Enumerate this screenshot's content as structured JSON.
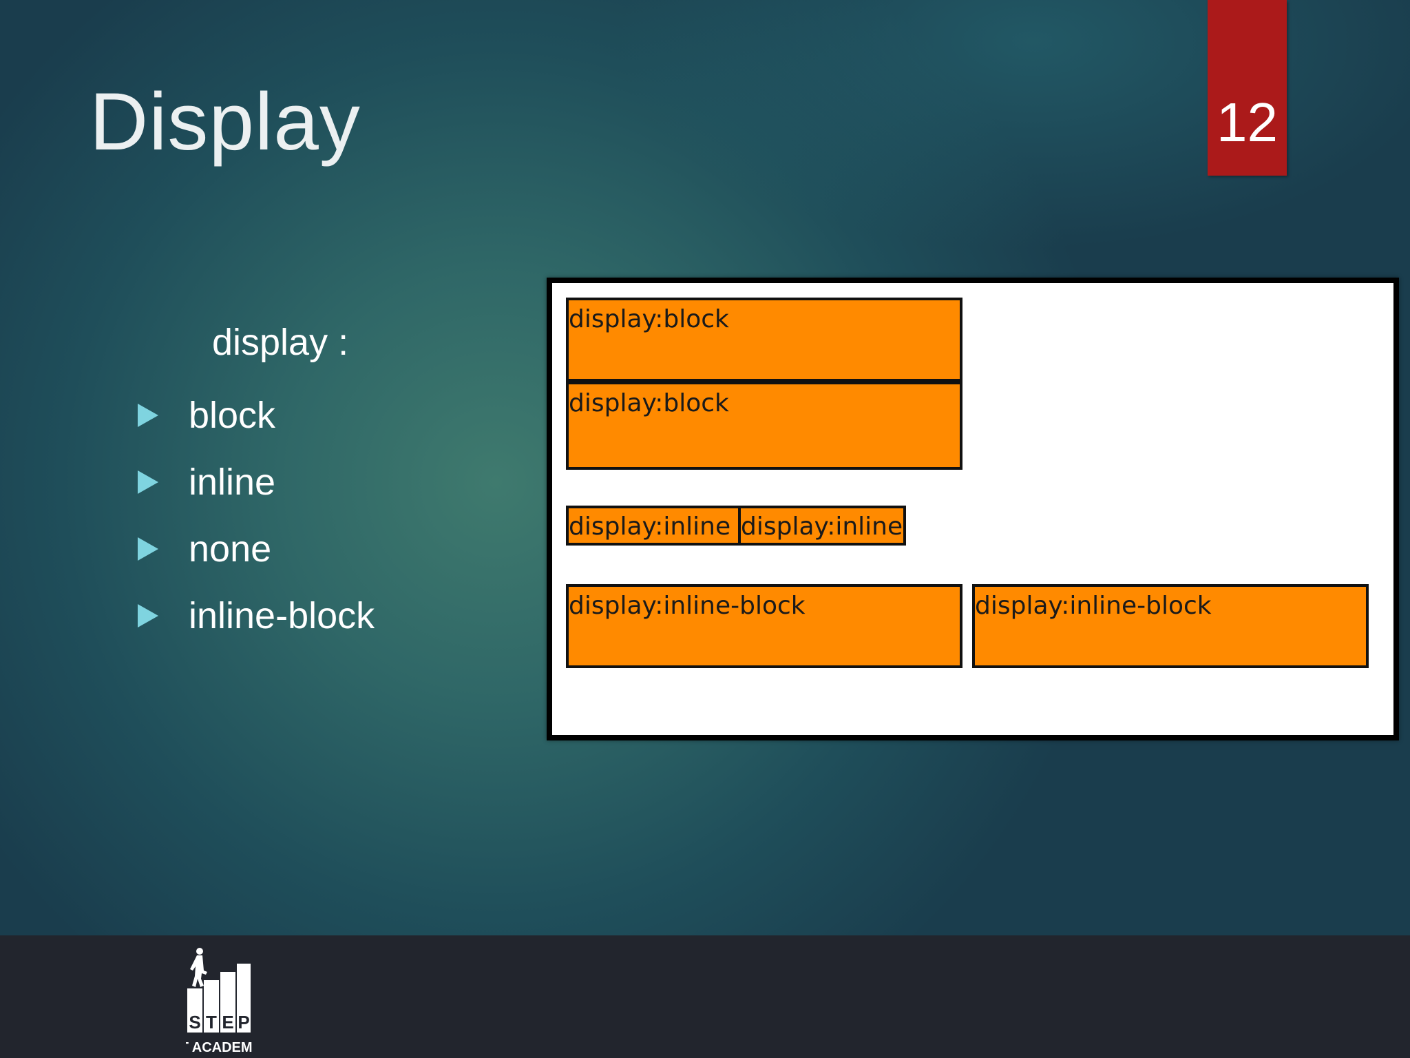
{
  "slide": {
    "title": "Display",
    "page_number": "12"
  },
  "bullets": {
    "heading": "display :",
    "items": [
      "block",
      "inline",
      "none",
      "inline-block"
    ]
  },
  "demo": {
    "block_1": "display:block",
    "block_2": "display:block",
    "inline_1": "display:inline",
    "inline_2": "display:inline",
    "inline_block_1": "display:inline-block",
    "inline_block_2": "display:inline-block",
    "box_color": "#ff8a00"
  },
  "footer": {
    "logo_text_top": "STEP",
    "logo_text_bottom": "IT ACADEMY"
  },
  "colors": {
    "page_number_bg": "#ab1a1a",
    "bullet_arrow": "#7fd4e0",
    "footer_bg": "#22252d"
  }
}
